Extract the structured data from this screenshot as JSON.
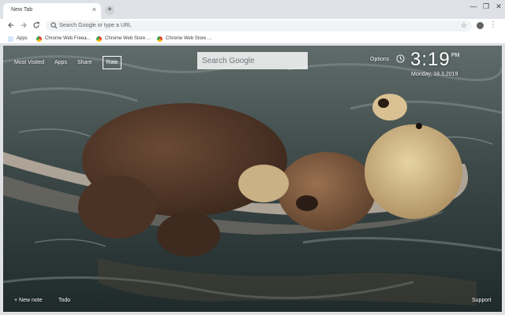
{
  "browser": {
    "tab_title": "New Tab",
    "tab_close": "×",
    "new_tab": "+",
    "window_controls": [
      "—",
      "❐",
      "✕"
    ],
    "omnibox_placeholder": "Search Google or type a URL",
    "bookmarks": {
      "apps_label": "Apps",
      "items": [
        "Chrome Web Freea...",
        "Chrome Web Store ...",
        "Chrome Web Store ..."
      ]
    }
  },
  "newtab": {
    "top_links": [
      "Most Visited",
      "Apps",
      "Share"
    ],
    "rate_label": "Rate",
    "search_placeholder": "Search Google",
    "options_label": "Options",
    "clock": {
      "time": "3:19",
      "ampm": "PM",
      "date": "Monday, 18.3.2019"
    },
    "bottom_left": [
      "+ New note",
      "Todo"
    ],
    "bottom_right": "Support"
  },
  "icons": {
    "back": "back-arrow-icon",
    "forward": "forward-arrow-icon",
    "reload": "reload-icon",
    "search": "search-icon",
    "star": "star-icon",
    "profile": "profile-icon",
    "menu": "kebab-menu-icon",
    "apps": "apps-grid-icon",
    "favicon": "chrome-web-store-icon",
    "clock": "clock-icon"
  },
  "colors": {
    "tabstrip": "#dee1e6",
    "omnibox": "#f1f3f4",
    "google_blue": "#4285f4"
  }
}
